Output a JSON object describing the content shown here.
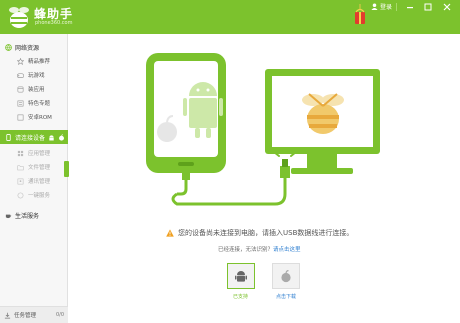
{
  "colors": {
    "accent": "#7cc22d",
    "link": "#2f7fd0",
    "warning": "#f0a020"
  },
  "header": {
    "brand": "蜂助手",
    "brand_sub": "phone360.com",
    "login_label": "登录",
    "icons": [
      "bee-logo-icon",
      "gift-icon",
      "user-icon",
      "minimize-icon",
      "maximize-icon",
      "close-icon"
    ]
  },
  "sidebar": {
    "network_section": "网络资源",
    "network_items": [
      {
        "label": "精品推荐",
        "icon": "star-icon"
      },
      {
        "label": "玩游戏",
        "icon": "gamepad-icon"
      },
      {
        "label": "装应用",
        "icon": "apps-icon"
      },
      {
        "label": "特色专题",
        "icon": "topic-icon"
      },
      {
        "label": "安卓ROM",
        "icon": "rom-icon"
      }
    ],
    "device_section": "请连接设备",
    "device_items": [
      {
        "label": "应用管理",
        "icon": "grid-icon"
      },
      {
        "label": "文件管理",
        "icon": "folder-icon"
      },
      {
        "label": "通讯管理",
        "icon": "contacts-icon"
      },
      {
        "label": "一键服务",
        "icon": "service-icon"
      }
    ],
    "life_section": "生活服务",
    "task_label": "任务管理",
    "task_count": "0/0"
  },
  "main": {
    "warning_text": "您的设备尚未连接到电脑，请插入USB数据线进行连接。",
    "sub_text": "已经连接，无法识别？",
    "help_link": "请点击这里",
    "android_label": "已支持",
    "ios_label": "点击下载"
  }
}
